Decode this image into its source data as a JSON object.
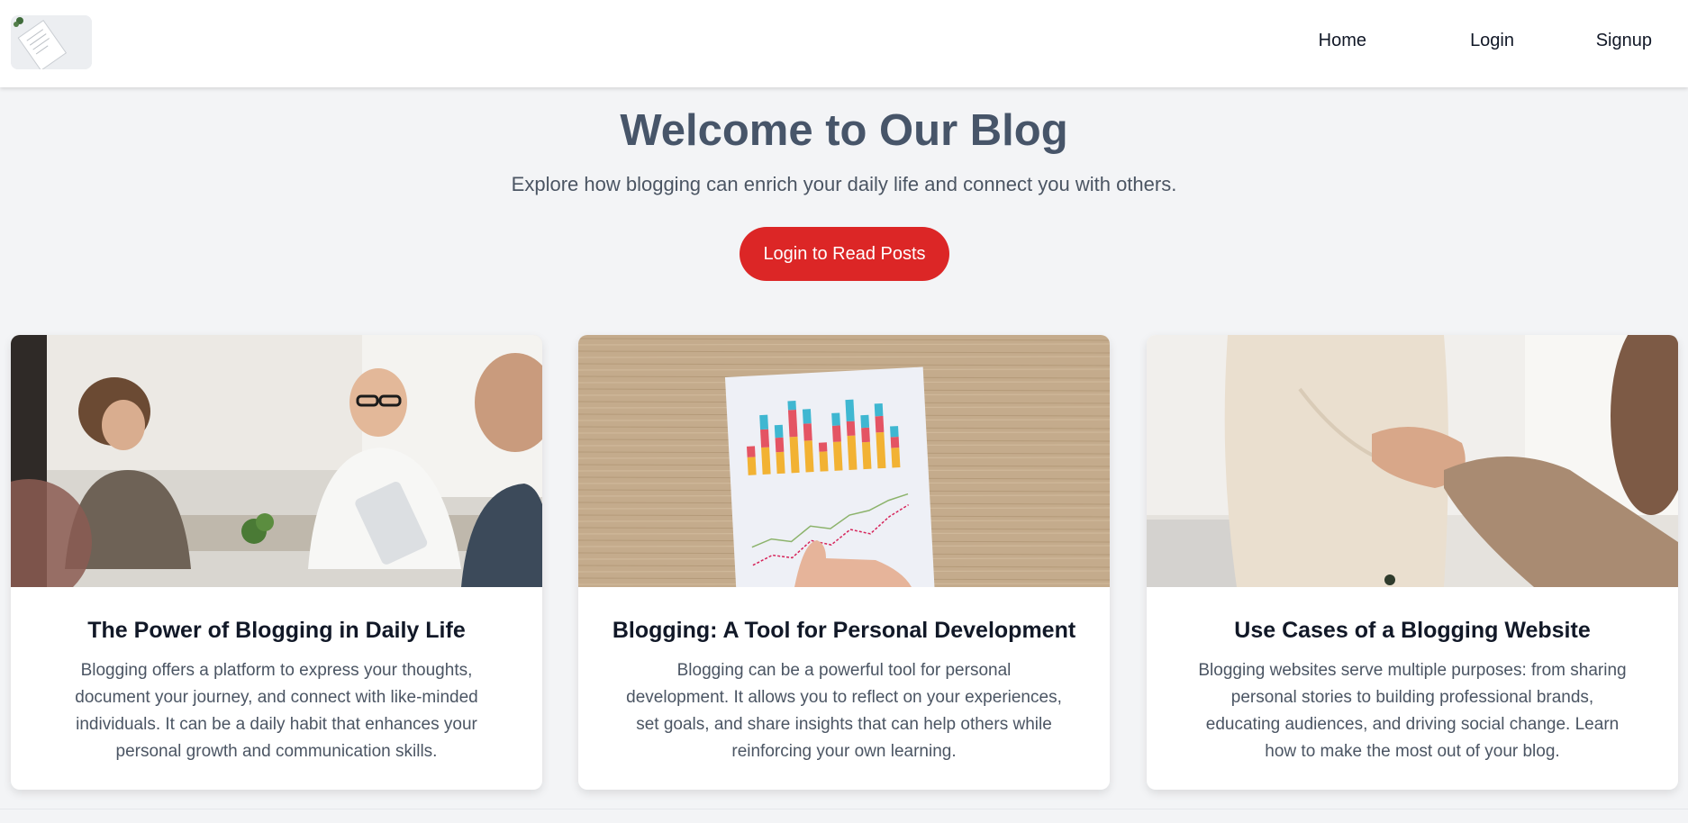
{
  "nav": {
    "links": [
      "Home",
      "Login",
      "Signup"
    ]
  },
  "hero": {
    "title": "Welcome to Our Blog",
    "subtitle": "Explore how blogging can enrich your daily life and connect you with others.",
    "cta_label": "Login to Read Posts"
  },
  "cards": [
    {
      "title": "The Power of Blogging in Daily Life",
      "body": "Blogging offers a platform to express your thoughts, document your journey, and connect with like-minded individuals. It can be a daily habit that enhances your personal growth and communication skills."
    },
    {
      "title": "Blogging: A Tool for Personal Development",
      "body": "Blogging can be a powerful tool for personal development. It allows you to reflect on your experiences, set goals, and share insights that can help others while reinforcing your own learning."
    },
    {
      "title": "Use Cases of a Blogging Website",
      "body": "Blogging websites serve multiple purposes: from sharing personal stories to building professional brands, educating audiences, and driving social change. Learn how to make the most out of your blog."
    }
  ],
  "colors": {
    "accent": "#dc2626",
    "background": "#f3f4f6",
    "heading": "#475569"
  }
}
